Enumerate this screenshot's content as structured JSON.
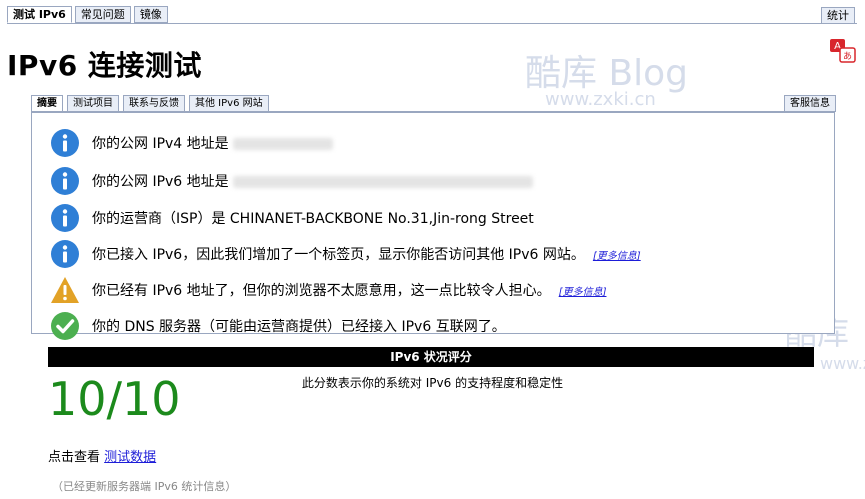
{
  "top_tabs": [
    "测试 IPv6",
    "常见问题",
    "镜像"
  ],
  "stats_tab": "统计",
  "page_title": "IPv6 连接测试",
  "sub_tabs": [
    "摘要",
    "测试项目",
    "联系与反馈",
    "其他 IPv6 网站"
  ],
  "service_tab": "客服信息",
  "watermarks": {
    "blog": "酷库 Blog",
    "url": "www.zxki.cn",
    "side": "酷库",
    "side_url": "www.z"
  },
  "results": [
    {
      "icon": "info-icon",
      "text": "你的公网 IPv4 地址是",
      "more": ""
    },
    {
      "icon": "info-icon",
      "text": "你的公网 IPv6 地址是",
      "more": ""
    },
    {
      "icon": "info-icon",
      "text": "你的运营商（ISP）是 CHINANET-BACKBONE No.31,Jin-rong Street",
      "more": ""
    },
    {
      "icon": "info-icon",
      "text": "你已接入 IPv6，因此我们增加了一个标签页，显示你能否访问其他 IPv6 网站。",
      "more": "[更多信息]"
    },
    {
      "icon": "warning-icon",
      "text": "你已经有 IPv6 地址了，但你的浏览器不太愿意用，这一点比较令人担心。",
      "more": "[更多信息]"
    },
    {
      "icon": "check-icon",
      "text": "你的 DNS 服务器（可能由运营商提供）已经接入 IPv6 互联网了。",
      "more": ""
    }
  ],
  "score": {
    "header": "IPv6 状况评分",
    "description": "此分数表示你的系统对 IPv6 的支持程度和稳定性",
    "value": "10/10"
  },
  "data_prefix": "点击查看",
  "data_link": "测试数据",
  "footnote": "（已经更新服务器端 IPv6 统计信息）",
  "colors": {
    "score": "#1c8a1c",
    "info": "#2f7fd6",
    "warning": "#e2a227",
    "ok": "#4caf50",
    "link": "#1d1dd8"
  }
}
